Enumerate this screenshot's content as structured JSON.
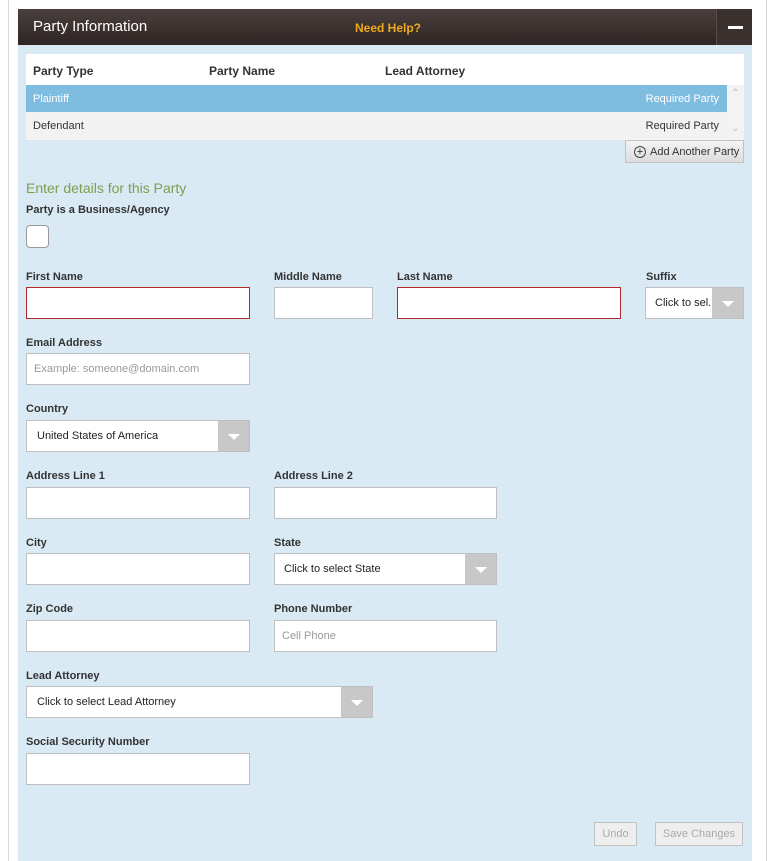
{
  "header": {
    "title": "Party Information",
    "help": "Need Help?"
  },
  "party_table": {
    "columns": [
      "Party Type",
      "Party Name",
      "Lead Attorney"
    ],
    "rows": [
      {
        "type": "Plaintiff",
        "name": "",
        "attorney": "",
        "status": "Required Party"
      },
      {
        "type": "Defendant",
        "name": "",
        "attorney": "",
        "status": "Required Party"
      }
    ]
  },
  "add_party_label": "Add Another Party",
  "form": {
    "section_title": "Enter details for this Party",
    "business_label": "Party is a Business/Agency",
    "first_name_label": "First Name",
    "middle_name_label": "Middle Name",
    "last_name_label": "Last Name",
    "suffix_label": "Suffix",
    "suffix_value": "Click to sel...",
    "email_label": "Email Address",
    "email_placeholder": "Example: someone@domain.com",
    "country_label": "Country",
    "country_value": "United States of America",
    "address1_label": "Address Line 1",
    "address2_label": "Address Line 2",
    "city_label": "City",
    "state_label": "State",
    "state_value": "Click to select State",
    "zip_label": "Zip Code",
    "phone_label": "Phone Number",
    "phone_placeholder": "Cell Phone",
    "attorney_label": "Lead Attorney",
    "attorney_value": "Click to select Lead Attorney",
    "ssn_label": "Social Security Number"
  },
  "footer": {
    "undo": "Undo",
    "save": "Save Changes"
  }
}
